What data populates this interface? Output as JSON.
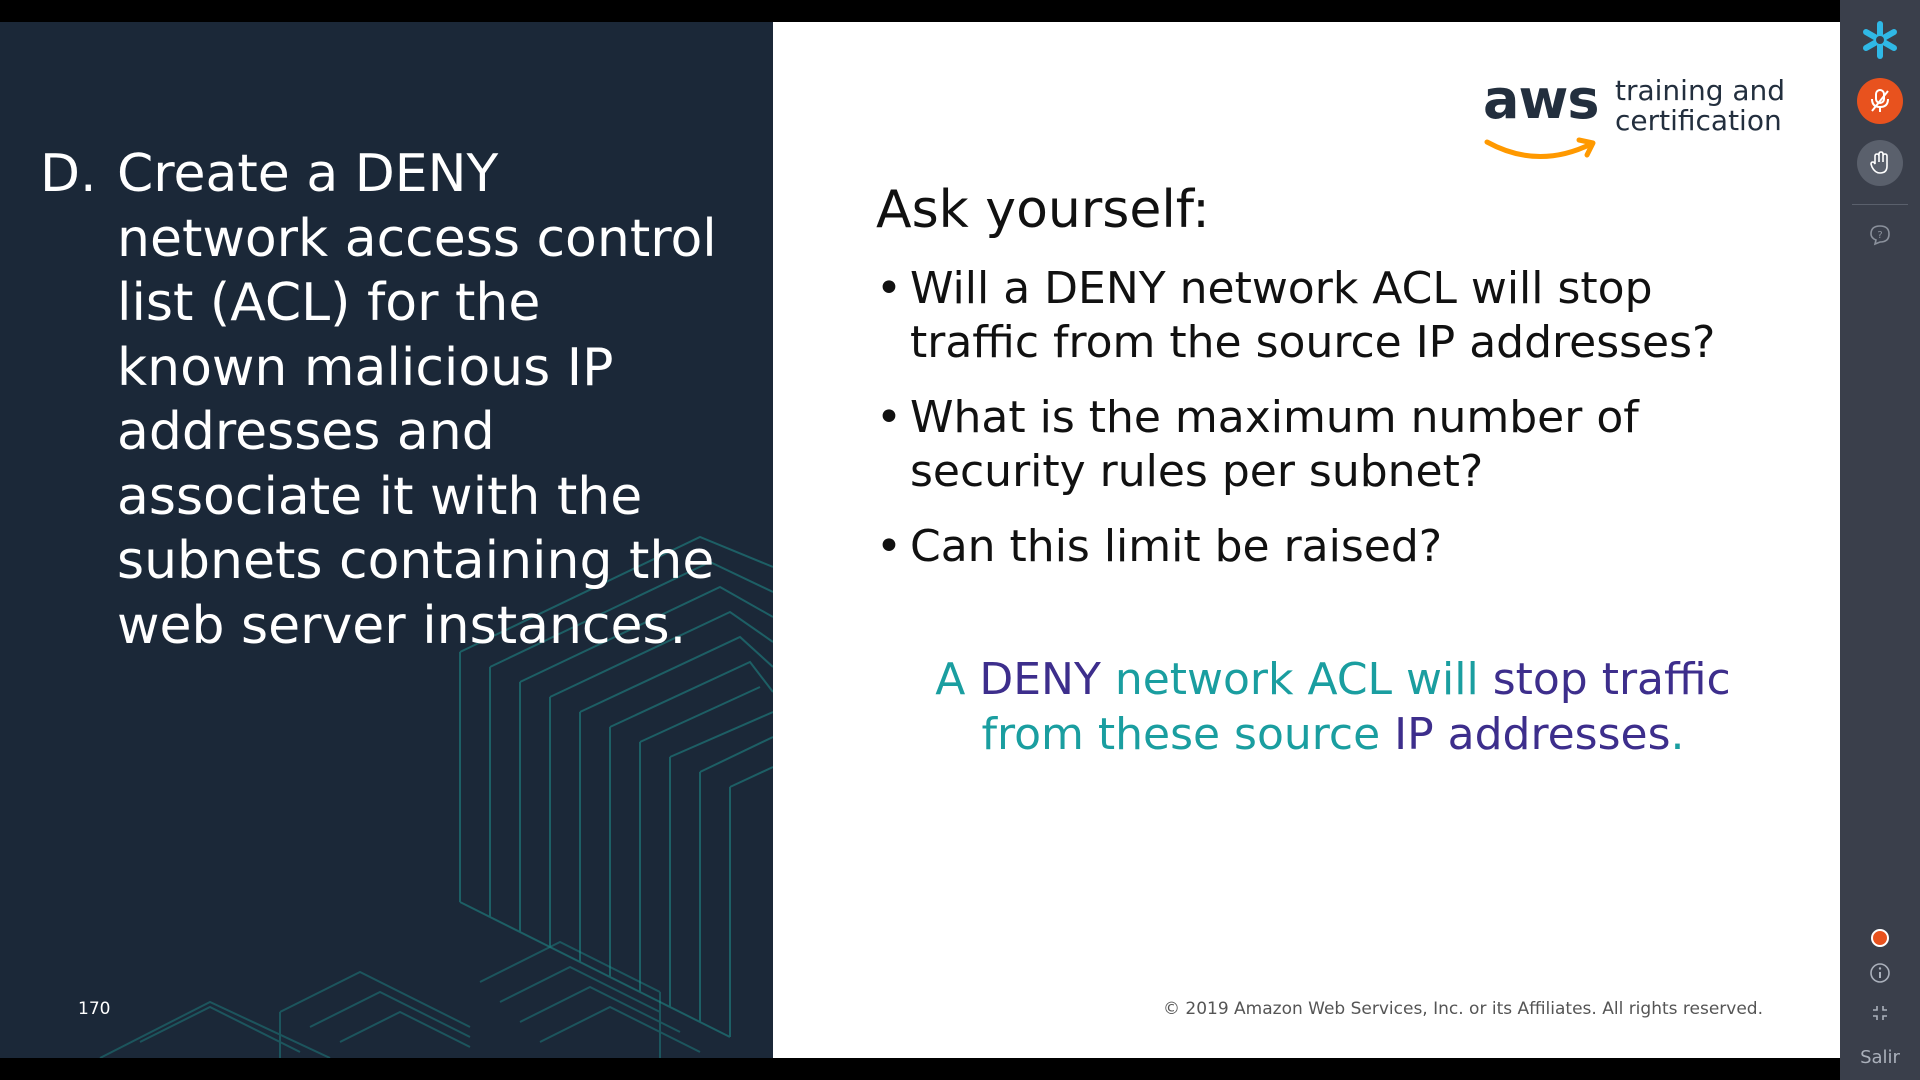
{
  "slide": {
    "number": "170",
    "option": {
      "letter": "D.",
      "text": "Create a DENY network access control list (ACL) for the known malicious IP addresses and associate it with the subnets containing the web server instances."
    },
    "logo": {
      "wordmark": "aws",
      "tagline_line1": "training and",
      "tagline_line2": "certification"
    },
    "ask_title": "Ask yourself:",
    "bullets": [
      "Will a DENY network ACL will stop traffic from the source IP addresses?",
      "What is the maximum number of security rules per subnet?",
      "Can this limit be raised?"
    ],
    "answer": {
      "part1": "A ",
      "part2": "DENY",
      "part3": " network ACL will ",
      "part4": "stop traffic",
      "part5": "from these source ",
      "part6": "IP addresses",
      "part7": "."
    },
    "copyright": "© 2019 Amazon Web Services, Inc. or its Affiliates. All rights reserved."
  },
  "sidebar": {
    "icons": [
      "asterisk-logo-icon",
      "microphone-icon",
      "raise-hand-icon",
      "help-icon",
      "record-icon",
      "info-icon",
      "fullscreen-icon"
    ],
    "exit_label": "Salir"
  },
  "colors": {
    "slide_left_bg": "#1b2838",
    "teal": "#1a9ea0",
    "purple": "#3d2e8c",
    "aws_orange": "#ff9900",
    "mic_orange": "#e8521e",
    "sidebar_bg": "#3a3f4b"
  }
}
